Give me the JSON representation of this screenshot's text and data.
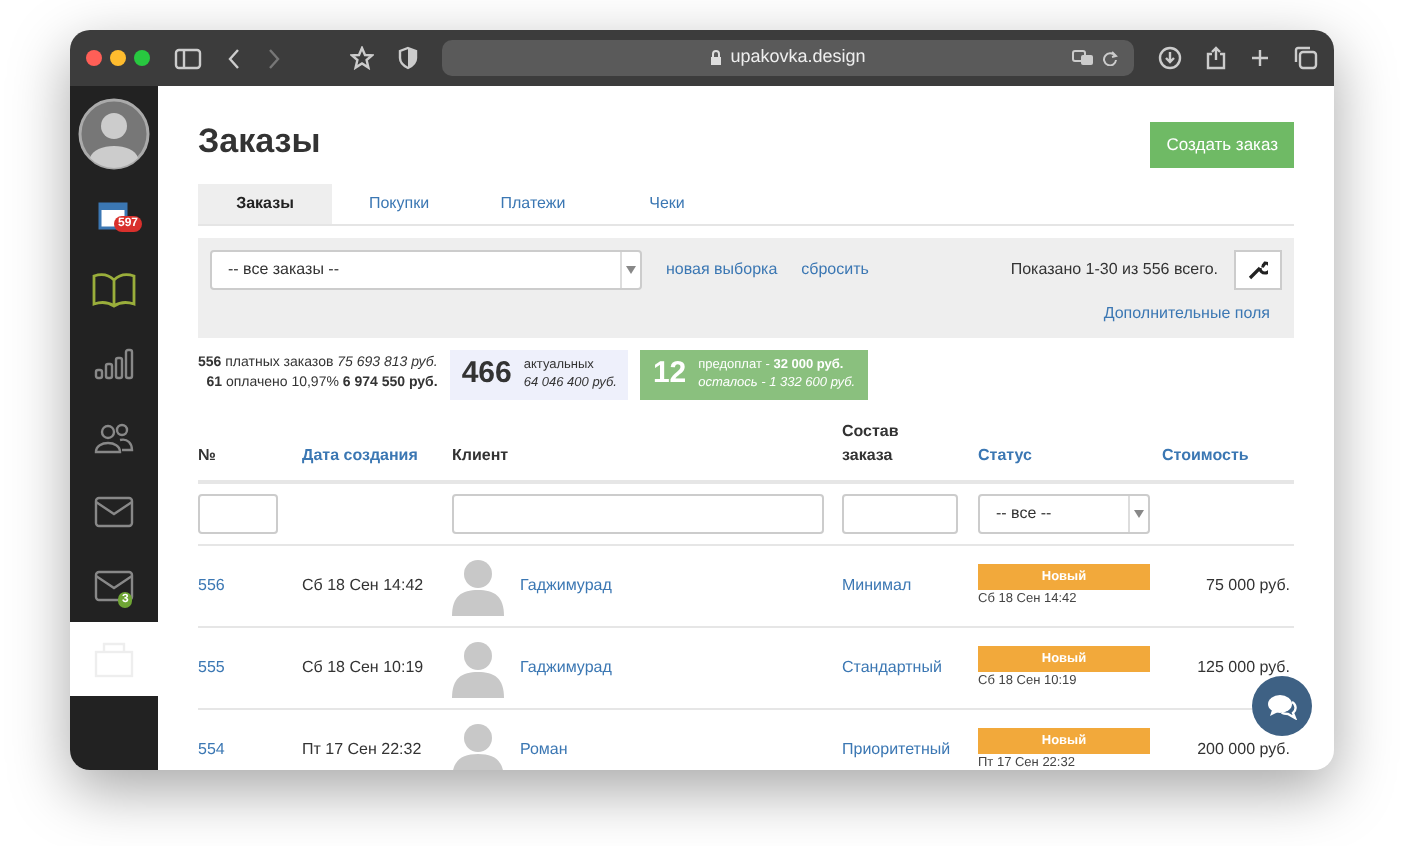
{
  "browser": {
    "url": "upakovka.design"
  },
  "sidebar": {
    "items": [
      {
        "kind": "avatar",
        "selected": false
      },
      {
        "kind": "calendar",
        "badge": "597",
        "selected": false
      },
      {
        "kind": "book",
        "selected": false
      },
      {
        "kind": "bars",
        "selected": false
      },
      {
        "kind": "people",
        "selected": false
      },
      {
        "kind": "mail",
        "selected": false
      },
      {
        "kind": "mail",
        "badge": "3",
        "selected": false
      },
      {
        "kind": "box",
        "selected": true
      }
    ]
  },
  "title": "Заказы",
  "create_button": "Создать заказ",
  "tabs": [
    {
      "label": "Заказы",
      "selected": true
    },
    {
      "label": "Покупки",
      "selected": false
    },
    {
      "label": "Платежи",
      "selected": false
    },
    {
      "label": "Чеки",
      "selected": false
    }
  ],
  "filter": {
    "select": "-- все заказы --",
    "links": [
      "новая выборка",
      "сбросить"
    ],
    "shown": "Показано 1-30 из 556 всего.",
    "extra_link": "Дополнительные поля"
  },
  "stats": {
    "paid_count": "556",
    "paid_label": "платных заказов",
    "paid_sum": "75 693 813 руб.",
    "payed_count": "61",
    "payed_label": "оплачено 10,97%",
    "payed_sum": "6 974 550 руб.",
    "actual_count": "466",
    "actual_label": "актуальных",
    "actual_sum": "64 046 400 руб.",
    "prepay_count": "12",
    "prepay_label": "предоплат - ",
    "prepay_sum": "32 000 руб.",
    "left_label": "осталось - 1 332 600 руб."
  },
  "table": {
    "columns": [
      {
        "label": "№",
        "sortable": false
      },
      {
        "label": "Дата создания",
        "sortable": true
      },
      {
        "label": "Клиент",
        "sortable": false
      },
      {
        "label": "Состав заказа",
        "sortable": false
      },
      {
        "label": "Статус",
        "sortable": true
      },
      {
        "label": "Стоимость",
        "sortable": true
      }
    ],
    "filters": [
      {
        "kind": "input"
      },
      {
        "kind": "none"
      },
      {
        "kind": "input"
      },
      {
        "kind": "input"
      },
      {
        "kind": "select",
        "value": "-- все --"
      },
      {
        "kind": "none"
      }
    ],
    "rows": [
      {
        "number": "556",
        "date": "Сб 18 Сен 14:42",
        "client": "Гаджимурад",
        "composition": "Минимал",
        "status": "Новый",
        "status_date": "Сб 18 Сен 14:42",
        "cost": "75 000 руб."
      },
      {
        "number": "555",
        "date": "Сб 18 Сен 10:19",
        "client": "Гаджимурад",
        "composition": "Стандартный",
        "status": "Новый",
        "status_date": "Сб 18 Сен 10:19",
        "cost": "125 000 руб."
      },
      {
        "number": "554",
        "date": "Пт 17 Сен 22:32",
        "client": "Роман",
        "composition": "Приоритетный",
        "status": "Новый",
        "status_date": "Пт 17 Сен 22:32",
        "cost": "200 000 руб."
      }
    ]
  }
}
